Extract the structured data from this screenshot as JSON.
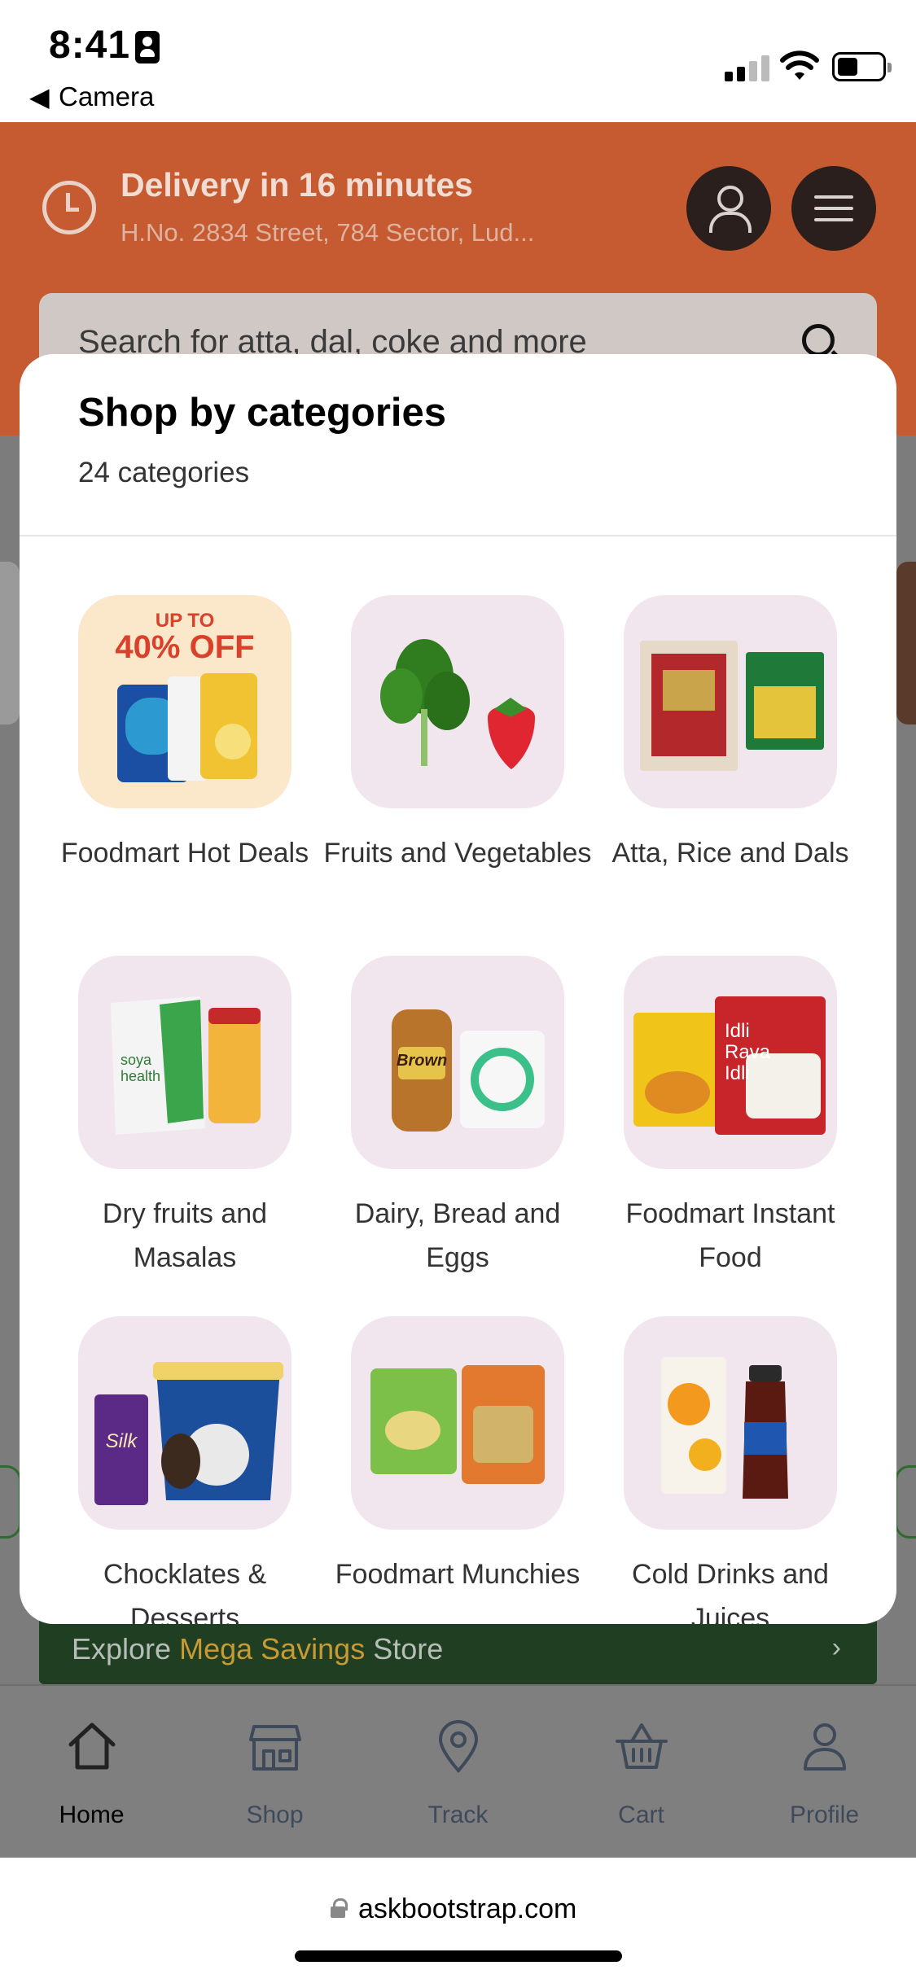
{
  "status_bar": {
    "time": "8:41",
    "back_label": "Camera",
    "back_arrow": "◀"
  },
  "header": {
    "delivery_title": "Delivery in 16 minutes",
    "address": "H.No. 2834 Street, 784 Sector, Lud...",
    "search_placeholder": "Search for atta, dal, coke and more",
    "brand_color": "#c65a30"
  },
  "modal": {
    "title": "Shop by categories",
    "subtitle": "24 categories",
    "categories": [
      {
        "label": "Foodmart Hot Deals",
        "icon": "hot-deals-offer-image",
        "badge_line1": "UP TO",
        "badge_line2": "40% OFF"
      },
      {
        "label": "Fruits and Vegetables",
        "icon": "spinach-strawberry-image"
      },
      {
        "label": "Atta, Rice and Dals",
        "icon": "atta-dal-packs-image"
      },
      {
        "label": "Dry fruits and Masalas",
        "icon": "masala-packs-image",
        "pack_text": "soya health"
      },
      {
        "label": "Dairy, Bread and Eggs",
        "icon": "bread-milk-image",
        "pack_text": "Brown"
      },
      {
        "label": "Foodmart Instant Food",
        "icon": "instant-food-packs-image",
        "pack_text": "Idli Rava Idli"
      },
      {
        "label": "Chocklates & Desserts",
        "icon": "chocolate-icecream-image",
        "pack_text": "Silk"
      },
      {
        "label": "Foodmart Munchies",
        "icon": "chips-snacks-image"
      },
      {
        "label": "Cold Drinks and Juices",
        "icon": "juice-cola-image"
      }
    ]
  },
  "explore_banner": {
    "prefix": "Explore ",
    "highlight": "Mega Savings",
    "suffix": " Store",
    "chevron": "›"
  },
  "bottom_nav": [
    {
      "label": "Home",
      "icon": "home-icon",
      "active": true
    },
    {
      "label": "Shop",
      "icon": "shop-icon",
      "active": false
    },
    {
      "label": "Track",
      "icon": "location-pin-icon",
      "active": false
    },
    {
      "label": "Cart",
      "icon": "basket-icon",
      "active": false
    },
    {
      "label": "Profile",
      "icon": "profile-icon",
      "active": false
    }
  ],
  "url_bar": {
    "url": "askbootstrap.com"
  }
}
